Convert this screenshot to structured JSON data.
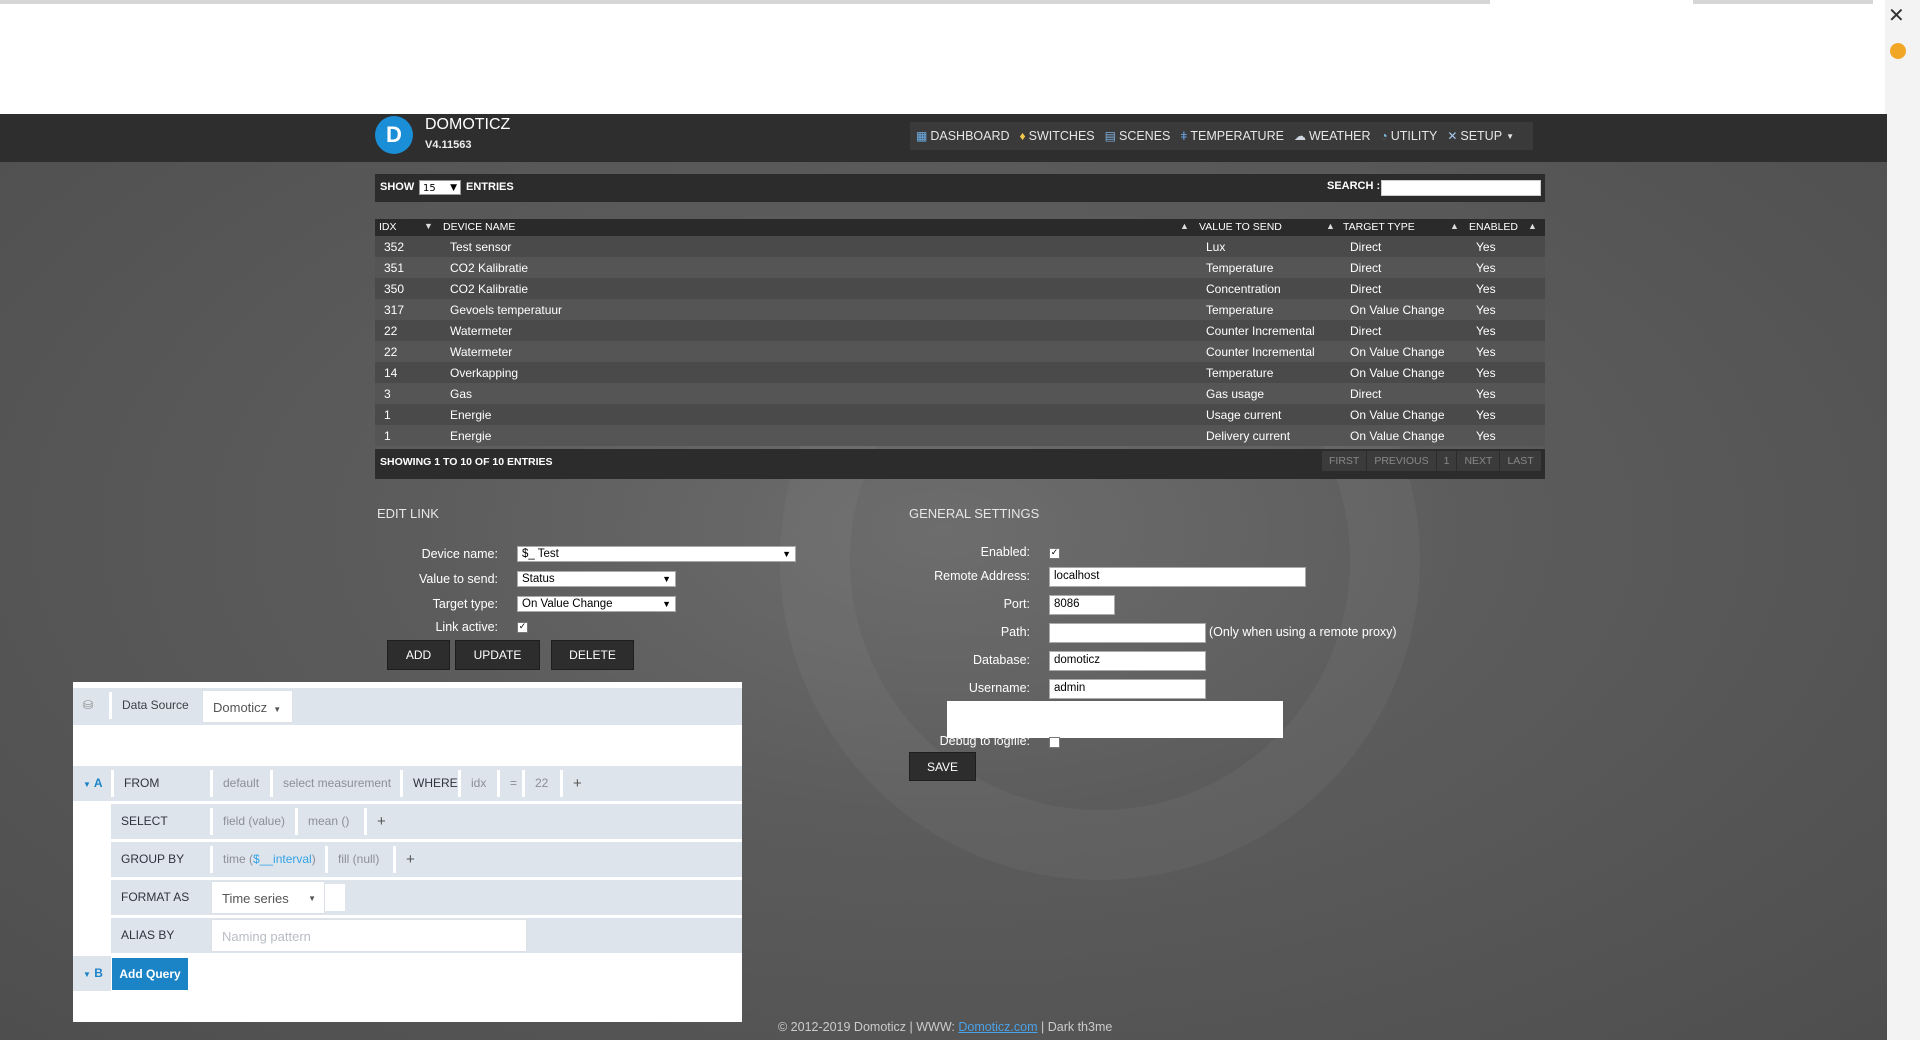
{
  "browser": {
    "close_glyph": "✕",
    "extension_glyph": "●"
  },
  "header": {
    "logo_glyph": "D",
    "brand": "DOMOTICZ",
    "version": "V4.11563",
    "nav": [
      {
        "label": "DASHBOARD",
        "icon": "dashboard-icon"
      },
      {
        "label": "SWITCHES",
        "icon": "bulb-icon"
      },
      {
        "label": "SCENES",
        "icon": "scene-icon"
      },
      {
        "label": "TEMPERATURE",
        "icon": "thermometer-icon"
      },
      {
        "label": "WEATHER",
        "icon": "weather-icon"
      },
      {
        "label": "UTILITY",
        "icon": "utility-icon"
      },
      {
        "label": "SETUP",
        "icon": "setup-icon"
      }
    ]
  },
  "table": {
    "show_label": "SHOW",
    "show_value": "15",
    "entries_label": "ENTRIES",
    "search_label": "SEARCH :",
    "columns": [
      "IDX",
      "DEVICE NAME",
      "VALUE TO SEND",
      "TARGET TYPE",
      "ENABLED"
    ],
    "rows": [
      [
        "352",
        "Test sensor",
        "Lux",
        "Direct",
        "Yes"
      ],
      [
        "351",
        "CO2 Kalibratie",
        "Temperature",
        "Direct",
        "Yes"
      ],
      [
        "350",
        "CO2 Kalibratie",
        "Concentration",
        "Direct",
        "Yes"
      ],
      [
        "317",
        "Gevoels temperatuur",
        "Temperature",
        "On Value Change",
        "Yes"
      ],
      [
        "22",
        "Watermeter",
        "Counter Incremental",
        "Direct",
        "Yes"
      ],
      [
        "22",
        "Watermeter",
        "Counter Incremental",
        "On Value Change",
        "Yes"
      ],
      [
        "14",
        "Overkapping",
        "Temperature",
        "On Value Change",
        "Yes"
      ],
      [
        "3",
        "Gas",
        "Gas usage",
        "Direct",
        "Yes"
      ],
      [
        "1",
        "Energie",
        "Usage current",
        "On Value Change",
        "Yes"
      ],
      [
        "1",
        "Energie",
        "Delivery current",
        "On Value Change",
        "Yes"
      ]
    ],
    "showing": "SHOWING 1 TO 10 OF 10 ENTRIES",
    "pager": [
      "FIRST",
      "PREVIOUS",
      "1",
      "NEXT",
      "LAST"
    ]
  },
  "edit_link": {
    "title": "EDIT LINK",
    "device_name_label": "Device name:",
    "device_name_value": "$_ Test",
    "value_to_send_label": "Value to send:",
    "value_to_send_value": "Status",
    "target_type_label": "Target type:",
    "target_type_value": "On Value Change",
    "link_active_label": "Link active:",
    "buttons": {
      "add": "ADD",
      "update": "UPDATE",
      "delete": "DELETE"
    }
  },
  "general": {
    "title": "GENERAL SETTINGS",
    "enabled_label": "Enabled:",
    "remote_address_label": "Remote Address:",
    "remote_address_value": "localhost",
    "port_label": "Port:",
    "port_value": "8086",
    "path_label": "Path:",
    "path_note": "(Only when using a remote proxy)",
    "database_label": "Database:",
    "database_value": "domoticz",
    "username_label": "Username:",
    "username_value": "admin",
    "debug_label": "Debug to logfile:",
    "save": "SAVE"
  },
  "query_editor": {
    "data_source_label": "Data Source",
    "data_source_value": "Domoticz",
    "query_a_letter": "A",
    "query_b_letter": "B",
    "from_label": "FROM",
    "from_default": "default",
    "from_measurement": "select measurement",
    "where_label": "WHERE",
    "where_key": "idx",
    "where_op": "=",
    "where_value": "22",
    "select_label": "SELECT",
    "select_field": "field (value)",
    "select_fn": "mean ()",
    "groupby_label": "GROUP BY",
    "groupby_time_prefix": "time (",
    "groupby_time_var": "$__interval",
    "groupby_time_suffix": ")",
    "groupby_fill": "fill (null)",
    "format_label": "FORMAT AS",
    "format_value": "Time series",
    "alias_label": "ALIAS BY",
    "alias_placeholder": "Naming pattern",
    "add_query": "Add Query",
    "plus": "+"
  },
  "footer": {
    "prefix": "© 2012-2019 Domoticz | WWW: ",
    "link": "Domoticz.com",
    "suffix": " | Dark th3me"
  },
  "colors": {
    "accent": "#1a8ed6",
    "header_bg": "#2e2e2e",
    "add_query": "#1b84c7"
  }
}
